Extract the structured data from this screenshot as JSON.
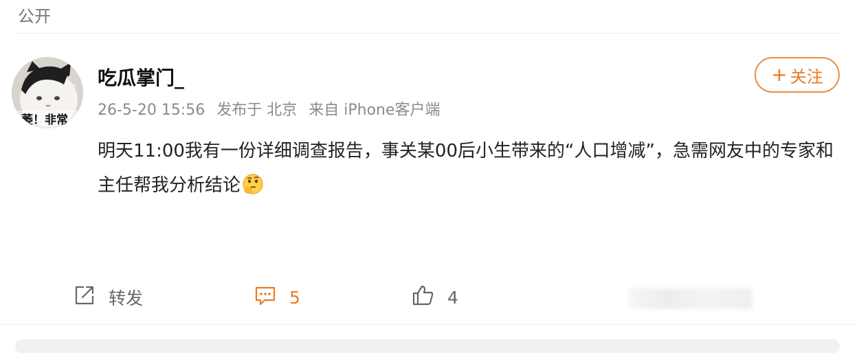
{
  "header": {
    "visibility": "公开"
  },
  "post": {
    "author": "吃瓜掌门_",
    "avatar_text": "萎！非常",
    "timestamp": "26-5-20 15:56",
    "location": "发布于 北京",
    "source": "来自 iPhone客户端",
    "follow_label": "关注",
    "content": "明天11:00我有一份详细调查报告，事关某00后小生带来的“人口增减”，急需网友中的专家和主任帮我分析结论",
    "emoji": "thinking-face-icon"
  },
  "actions": {
    "repost_label": "转发",
    "comment_count": "5",
    "like_count": "4"
  },
  "colors": {
    "accent": "#ec7a22",
    "muted": "#8a8a8a"
  }
}
